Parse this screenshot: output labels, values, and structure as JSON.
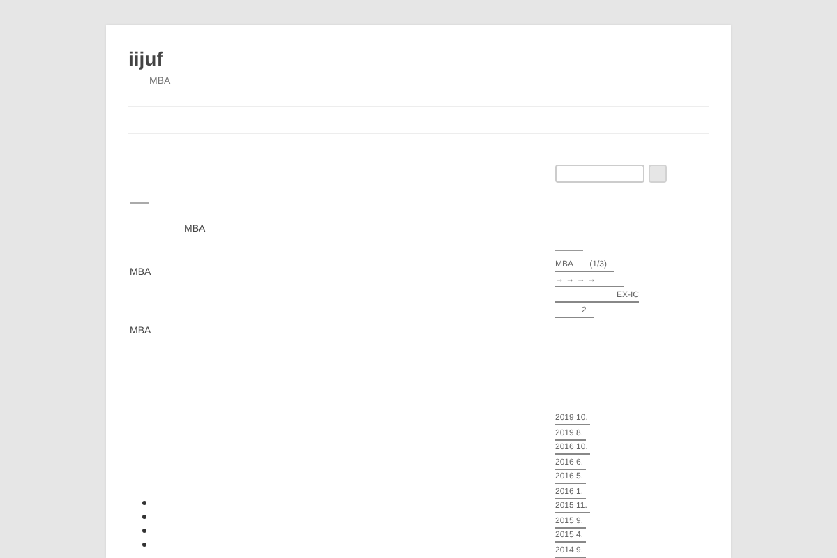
{
  "site": {
    "title": "iijuf",
    "tagline": "MBA"
  },
  "main": {
    "paragraphs": [
      {
        "text": "MBA",
        "indented": true
      },
      {
        "text": "MBA",
        "indented": false
      },
      {
        "text": "MBA",
        "indented": false
      }
    ]
  },
  "sidebar": {
    "recent_posts": [
      "MBA　　(1/3)",
      "→ → → →",
      "EX-IC",
      "2"
    ],
    "archives": [
      "2019 10.",
      "2019 8.",
      "2016 10.",
      "2016 6.",
      "2016 5.",
      "2016 1.",
      "2015 11.",
      "2015 9.",
      "2015 4.",
      "2014 9."
    ]
  }
}
